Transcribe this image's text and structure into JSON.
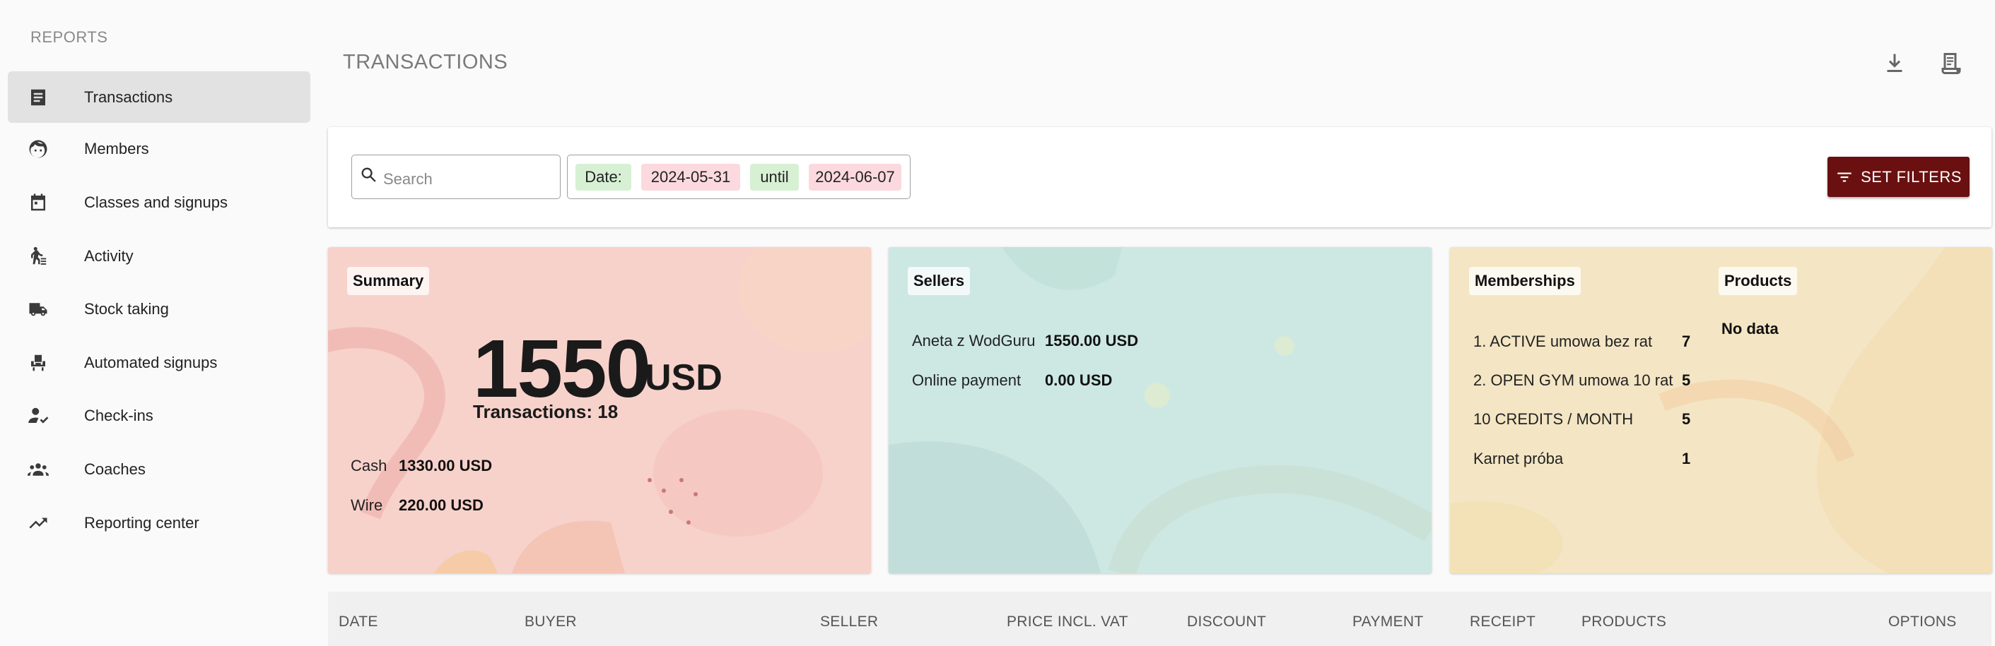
{
  "sidebar": {
    "heading": "REPORTS",
    "items": [
      {
        "label": "Transactions",
        "icon": "receipt-list-icon",
        "active": true
      },
      {
        "label": "Members",
        "icon": "face-icon"
      },
      {
        "label": "Classes and signups",
        "icon": "calendar-icon"
      },
      {
        "label": "Activity",
        "icon": "walking-person-icon"
      },
      {
        "label": "Stock taking",
        "icon": "truck-icon"
      },
      {
        "label": "Automated signups",
        "icon": "seat-icon"
      },
      {
        "label": "Check-ins",
        "icon": "person-check-icon"
      },
      {
        "label": "Coaches",
        "icon": "group-icon"
      },
      {
        "label": "Reporting center",
        "icon": "trending-up-icon"
      }
    ]
  },
  "header": {
    "title": "TRANSACTIONS",
    "actions": [
      "download-icon",
      "receipt-icon"
    ]
  },
  "filters": {
    "search_placeholder": "Search",
    "date_label": "Date:",
    "date_from": "2024-05-31",
    "until_label": "until",
    "date_to": "2024-06-07",
    "set_filters_label": "SET FILTERS"
  },
  "summary": {
    "tag": "Summary",
    "amount": "1550",
    "currency": "USD",
    "transactions": "Transactions: 18",
    "rows": [
      {
        "label": "Cash",
        "value": "1330.00 USD"
      },
      {
        "label": "Wire",
        "value": "220.00 USD"
      }
    ]
  },
  "sellers": {
    "tag": "Sellers",
    "rows": [
      {
        "label": "Aneta z WodGuru",
        "value": "1550.00 USD"
      },
      {
        "label": "Online payment",
        "value": "0.00 USD"
      }
    ]
  },
  "memberships": {
    "tag": "Memberships",
    "rows": [
      {
        "label": "1. ACTIVE umowa bez rat",
        "value": "7"
      },
      {
        "label": "2. OPEN GYM umowa 10 rat",
        "value": "5"
      },
      {
        "label": "10 CREDITS / MONTH",
        "value": "5"
      },
      {
        "label": "Karnet próba",
        "value": "1"
      }
    ]
  },
  "products": {
    "tag": "Products",
    "empty": "No data"
  },
  "table": {
    "columns": [
      "DATE",
      "BUYER",
      "SELLER",
      "PRICE INCL. VAT",
      "DISCOUNT",
      "PAYMENT",
      "RECEIPT",
      "PRODUCTS",
      "OPTIONS"
    ]
  },
  "colors": {
    "accent": "#6a1010",
    "summary_bg": "#f7d2cb",
    "sellers_bg": "#cde8e3",
    "members_bg": "#f4e6c4",
    "chip_green": "#d7f0d4",
    "chip_pink": "#fbd9df"
  }
}
